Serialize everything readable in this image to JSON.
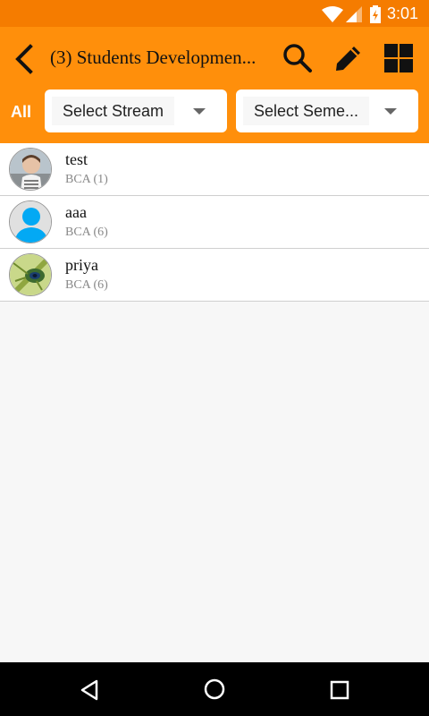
{
  "status_bar": {
    "time": "3:01"
  },
  "toolbar": {
    "title": "(3) Students Developmen...",
    "icons": {
      "back": "arrow-back-icon",
      "search": "search-icon",
      "edit": "pencil-icon",
      "grid": "grid-view-icon"
    }
  },
  "filters": {
    "all_label": "All",
    "stream": {
      "label": "Select Stream"
    },
    "semester": {
      "label": "Select Seme..."
    }
  },
  "students": [
    {
      "name": "test",
      "detail": "BCA (1)",
      "avatar": "photo"
    },
    {
      "name": "aaa",
      "detail": "BCA (6)",
      "avatar": "default-person-icon"
    },
    {
      "name": "priya",
      "detail": "BCA (6)",
      "avatar": "photo"
    }
  ],
  "colors": {
    "accent": "#ff8f0b",
    "status_bar": "#f57c00",
    "avatar_default": "#03a9f4"
  }
}
